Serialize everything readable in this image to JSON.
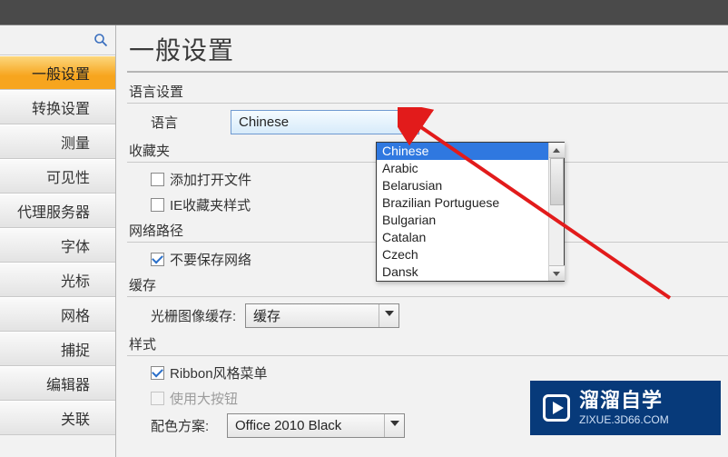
{
  "nav": {
    "items": [
      "一般设置",
      "转换设置",
      "测量",
      "可见性",
      "代理服务器",
      "字体",
      "光标",
      "网格",
      "捕捉",
      "编辑器",
      "关联"
    ]
  },
  "page_title": "一般设置",
  "lang_section": {
    "header": "语言设置",
    "label": "语言",
    "selected": "Chinese",
    "options": [
      "Chinese",
      "Arabic",
      "Belarusian",
      "Brazilian Portuguese",
      "Bulgarian",
      "Catalan",
      "Czech",
      "Dansk"
    ]
  },
  "fav_section": {
    "header": "收藏夹",
    "cb1": {
      "label": "添加打开文件",
      "checked": false
    },
    "cb2": {
      "label": "IE收藏夹样式",
      "checked": false
    }
  },
  "net_section": {
    "header": "网络路径",
    "cb": {
      "label": "不要保存网络",
      "checked": true
    }
  },
  "cache_section": {
    "header": "缓存",
    "label": "光栅图像缓存:",
    "value": "缓存"
  },
  "style_section": {
    "header": "样式",
    "cb1": {
      "label": "Ribbon风格菜单",
      "checked": true
    },
    "cb2": {
      "label": "使用大按钮",
      "checked": false,
      "disabled": true
    },
    "scheme_label": "配色方案:",
    "scheme_value": "Office 2010 Black"
  },
  "badge": {
    "title": "溜溜自学",
    "sub": "ZIXUE.3D66.COM"
  }
}
